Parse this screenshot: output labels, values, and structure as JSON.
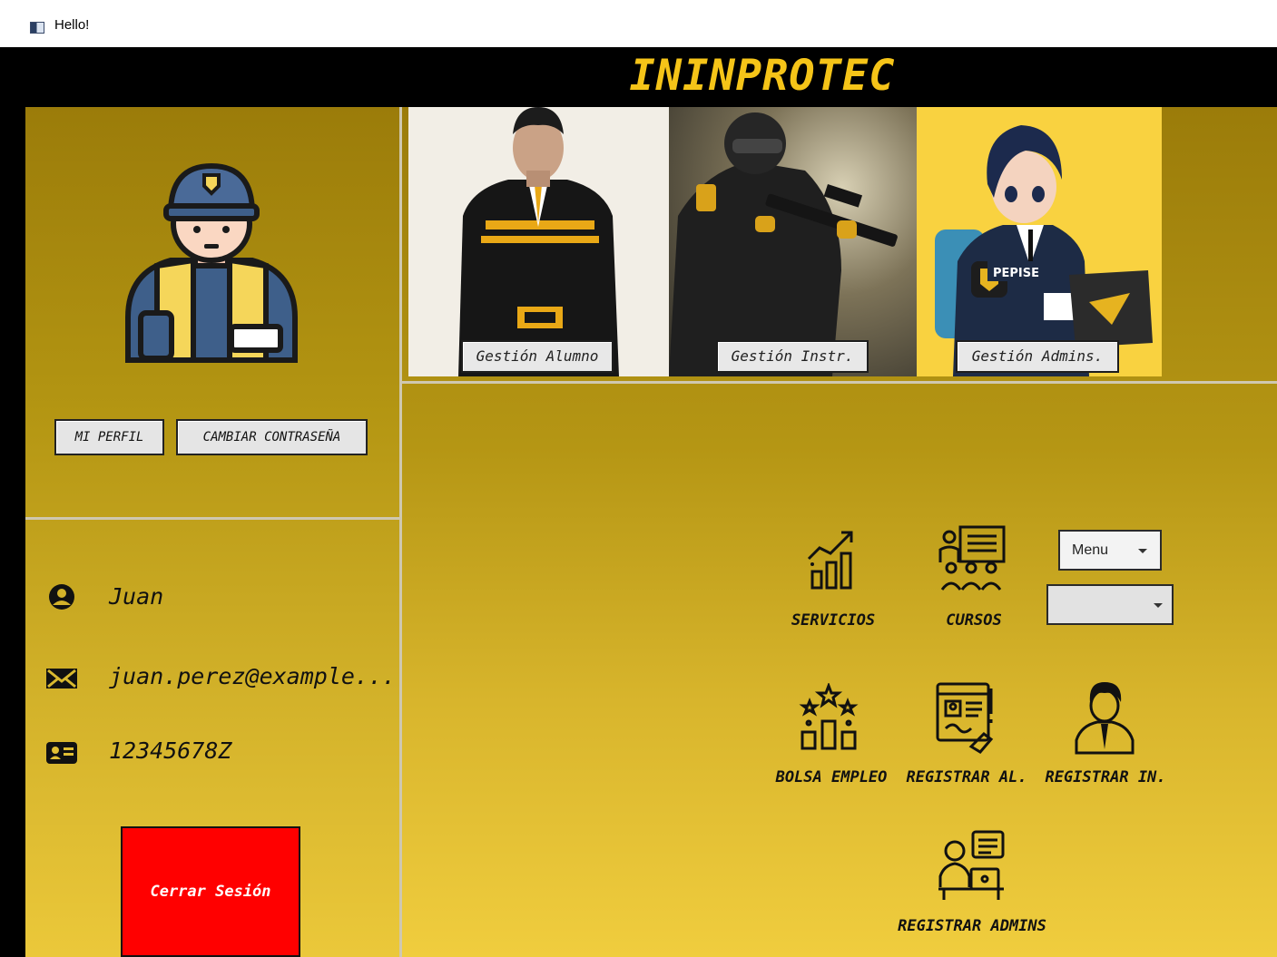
{
  "window": {
    "title": "Hello!"
  },
  "header": {
    "brand": "ININPROTEC"
  },
  "gallery": {
    "student_button": "Gestión Alumno",
    "instructor_button": "Gestión Instr.",
    "admin_button": "Gestión Admins.",
    "patch_text": "PEPISE"
  },
  "profile": {
    "my_profile_button": "MI PERFIL",
    "change_password_button": "CAMBIAR CONTRASEÑA",
    "name": "Juan",
    "email": "juan.perez@example...",
    "id_number": "12345678Z",
    "logout_button": "Cerrar Sesión"
  },
  "menu": {
    "services": "SERVICIOS",
    "courses": "CURSOS",
    "job_board": "BOLSA EMPLEO",
    "register_student": "REGISTRAR AL.",
    "register_instructor": "REGISTRAR IN.",
    "register_admins": "REGISTRAR ADMINS",
    "dropdown_menu_value": "Menu",
    "dropdown_second_value": ""
  },
  "colors": {
    "brand": "#f5c418",
    "panel_top": "#9b7c0a",
    "panel_bottom": "#f0cd3e",
    "logout": "#ff0000"
  },
  "icons": [
    "app-window-icon",
    "user-icon",
    "envelope-icon",
    "id-card-icon",
    "growth-chart-icon",
    "classroom-icon",
    "stars-chart-icon",
    "registration-form-icon",
    "instructor-person-icon",
    "admin-desk-icon"
  ]
}
